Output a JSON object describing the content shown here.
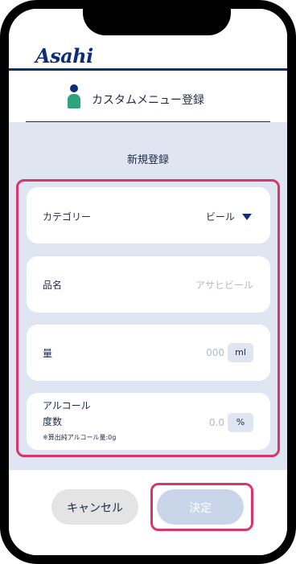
{
  "brand": {
    "logo_text": "Asahi",
    "brand_color": "#0d2d78",
    "accent_color": "#d8366a"
  },
  "page": {
    "title": "カスタムメニュー登録",
    "title_icon": "person-icon",
    "subtitle": "新規登録"
  },
  "form": {
    "category": {
      "label": "カテゴリー",
      "selected": "ビール",
      "icon": "caret-down-icon"
    },
    "name": {
      "label": "品名",
      "placeholder": "アサヒビール"
    },
    "amount": {
      "label": "量",
      "placeholder": "000",
      "unit": "ml"
    },
    "alcohol": {
      "label_line1": "アルコール",
      "label_line2": "度数",
      "placeholder": "0.0",
      "unit": "%",
      "note": "※算出純アルコール量:0g"
    }
  },
  "buttons": {
    "cancel": "キャンセル",
    "confirm": "決定"
  }
}
